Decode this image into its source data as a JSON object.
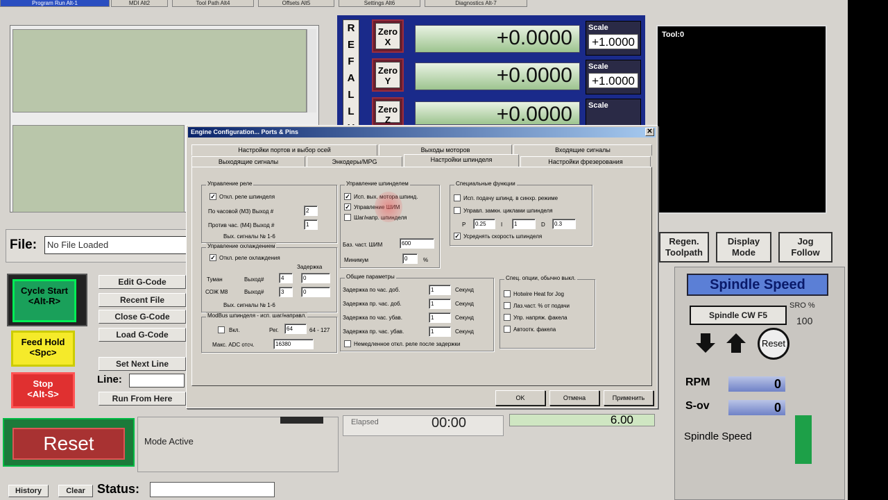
{
  "top_tabs": [
    "Program Run Alt-1",
    "MDI Alt2",
    "Tool Path Alt4",
    "Offsets Alt5",
    "Settings Alt6",
    "Diagnostics Alt-7"
  ],
  "ref_all": [
    "R",
    "E",
    "F",
    "A",
    "L",
    "L",
    "H"
  ],
  "dro": {
    "x": {
      "zero": "Zero\nX",
      "value": "+0.0000",
      "scale_label": "Scale",
      "scale": "+1.0000"
    },
    "y": {
      "zero": "Zero\nY",
      "value": "+0.0000",
      "scale_label": "Scale",
      "scale": "+1.0000"
    },
    "z": {
      "zero": "Zero\nZ",
      "value": "+0.0000",
      "scale_label": "Scale"
    }
  },
  "tool_label": "Tool:0",
  "file": {
    "label": "File:",
    "value": "No File Loaded"
  },
  "buttons": {
    "cycle_start": "Cycle Start\n<Alt-R>",
    "feed_hold": "Feed Hold\n<Spc>",
    "stop": "Stop\n<Alt-S>",
    "edit_gcode": "Edit G-Code",
    "recent_file": "Recent File",
    "close_gcode": "Close G-Code",
    "load_gcode": "Load G-Code",
    "set_next_line": "Set Next Line",
    "line_label": "Line:",
    "run_from_here": "Run From Here",
    "regen": "Regen.\nToolpath",
    "display_mode": "Display\nMode",
    "jog_follow": "Jog\nFollow",
    "reset_big": "Reset",
    "history": "History",
    "clear": "Clear",
    "status_label": "Status:",
    "mode_active": "Mode Active"
  },
  "spindle": {
    "title": "Spindle Speed",
    "cw": "Spindle CW F5",
    "sro_label": "SRO %",
    "sro_value": "100",
    "reset": "Reset",
    "rpm_label": "RPM",
    "rpm": "0",
    "sov_label": "S-ov",
    "sov": "0",
    "speed_label": "Spindle Speed"
  },
  "elapsed": {
    "label": "Elapsed",
    "value": "00:00"
  },
  "misc_values": {
    "feed": "6.00"
  },
  "dialog": {
    "title": "Engine Configuration... Ports & Pins",
    "tabs_row1": [
      "Настройки портов и выбор осей",
      "Выходы моторов",
      "Входящие сигналы"
    ],
    "tabs_row2": [
      "Выходящие сигналы",
      "Энкодеры/MPG",
      "Настройки шпинделя",
      "Настройки фрезерования"
    ],
    "relay": {
      "title": "Управление реле",
      "disable": "Откл. реле шпинделя",
      "cw": "По часовой (M3) Выход #",
      "cw_val": "2",
      "ccw": "Против час. (M4) Выход #",
      "ccw_val": "1",
      "outs": "Вых. сигналы № 1-6"
    },
    "coolant": {
      "title": "Управление охлаждением",
      "disable": "Откл. реле охлаждения",
      "delay": "Задержка",
      "mist": "Туман",
      "mist_out": "Выход#",
      "mist_val": "4",
      "mist_delay": "0",
      "flood": "СОЖ M8",
      "flood_out": "Выход#",
      "flood_val": "3",
      "flood_delay": "0",
      "outs": "Вых. сигналы № 1-6"
    },
    "modbus": {
      "title": "ModBus шпинделя - исп. шаг/направл.",
      "enabled": "Вкл.",
      "reg": "Рег.",
      "reg_val": "64",
      "range": "64 - 127",
      "adc": "Макс. ADC отсч.",
      "adc_val": "16380"
    },
    "motor": {
      "title": "Управление шпинделем",
      "use_motor": "Исп. вых. мотора шпинд.",
      "pwm": "Управление ШИМ",
      "step_dir": "Шаг/напр. шпинделя",
      "pwm_freq": "Баз. част. ШИМ",
      "pwm_freq_val": "600",
      "minimum": "Минимум",
      "minimum_val": "0",
      "pct": "%"
    },
    "special": {
      "title": "Специальные функции",
      "feedback": "Исп. подачу шпинд. в синхр. режиме",
      "closed_loop": "Управл. замкн. циклами шпинделя",
      "p": "P",
      "p_val": "0.25",
      "i": "I",
      "i_val": "1",
      "d": "D",
      "d_val": "0.3",
      "average": "Усреднять скорость шпинделя"
    },
    "general": {
      "title": "Общие параметры",
      "rows": [
        {
          "label": "Задержка по час. доб.",
          "val": "1",
          "unit": "Секунд"
        },
        {
          "label": "Задержка пр. час. доб.",
          "val": "1",
          "unit": "Секунд"
        },
        {
          "label": "Задержка по час. убав.",
          "val": "1",
          "unit": "Секунд"
        },
        {
          "label": "Задержка пр. час. убав.",
          "val": "1",
          "unit": "Секунд"
        }
      ],
      "immediate": "Немедленное откл. реле после задержки"
    },
    "options": {
      "title": "Спец. опции, обычно выкл.",
      "items": [
        "Hotwire Heat for Jog",
        "Лаз.част. % от подачи",
        "Упр. напряж. факела",
        "Автоотк. факела"
      ]
    },
    "ok": "OK",
    "cancel": "Отмена",
    "apply": "Применить"
  },
  "colors": {
    "dro_frame": "#1a2a8a",
    "subtitle": "#e01010"
  }
}
